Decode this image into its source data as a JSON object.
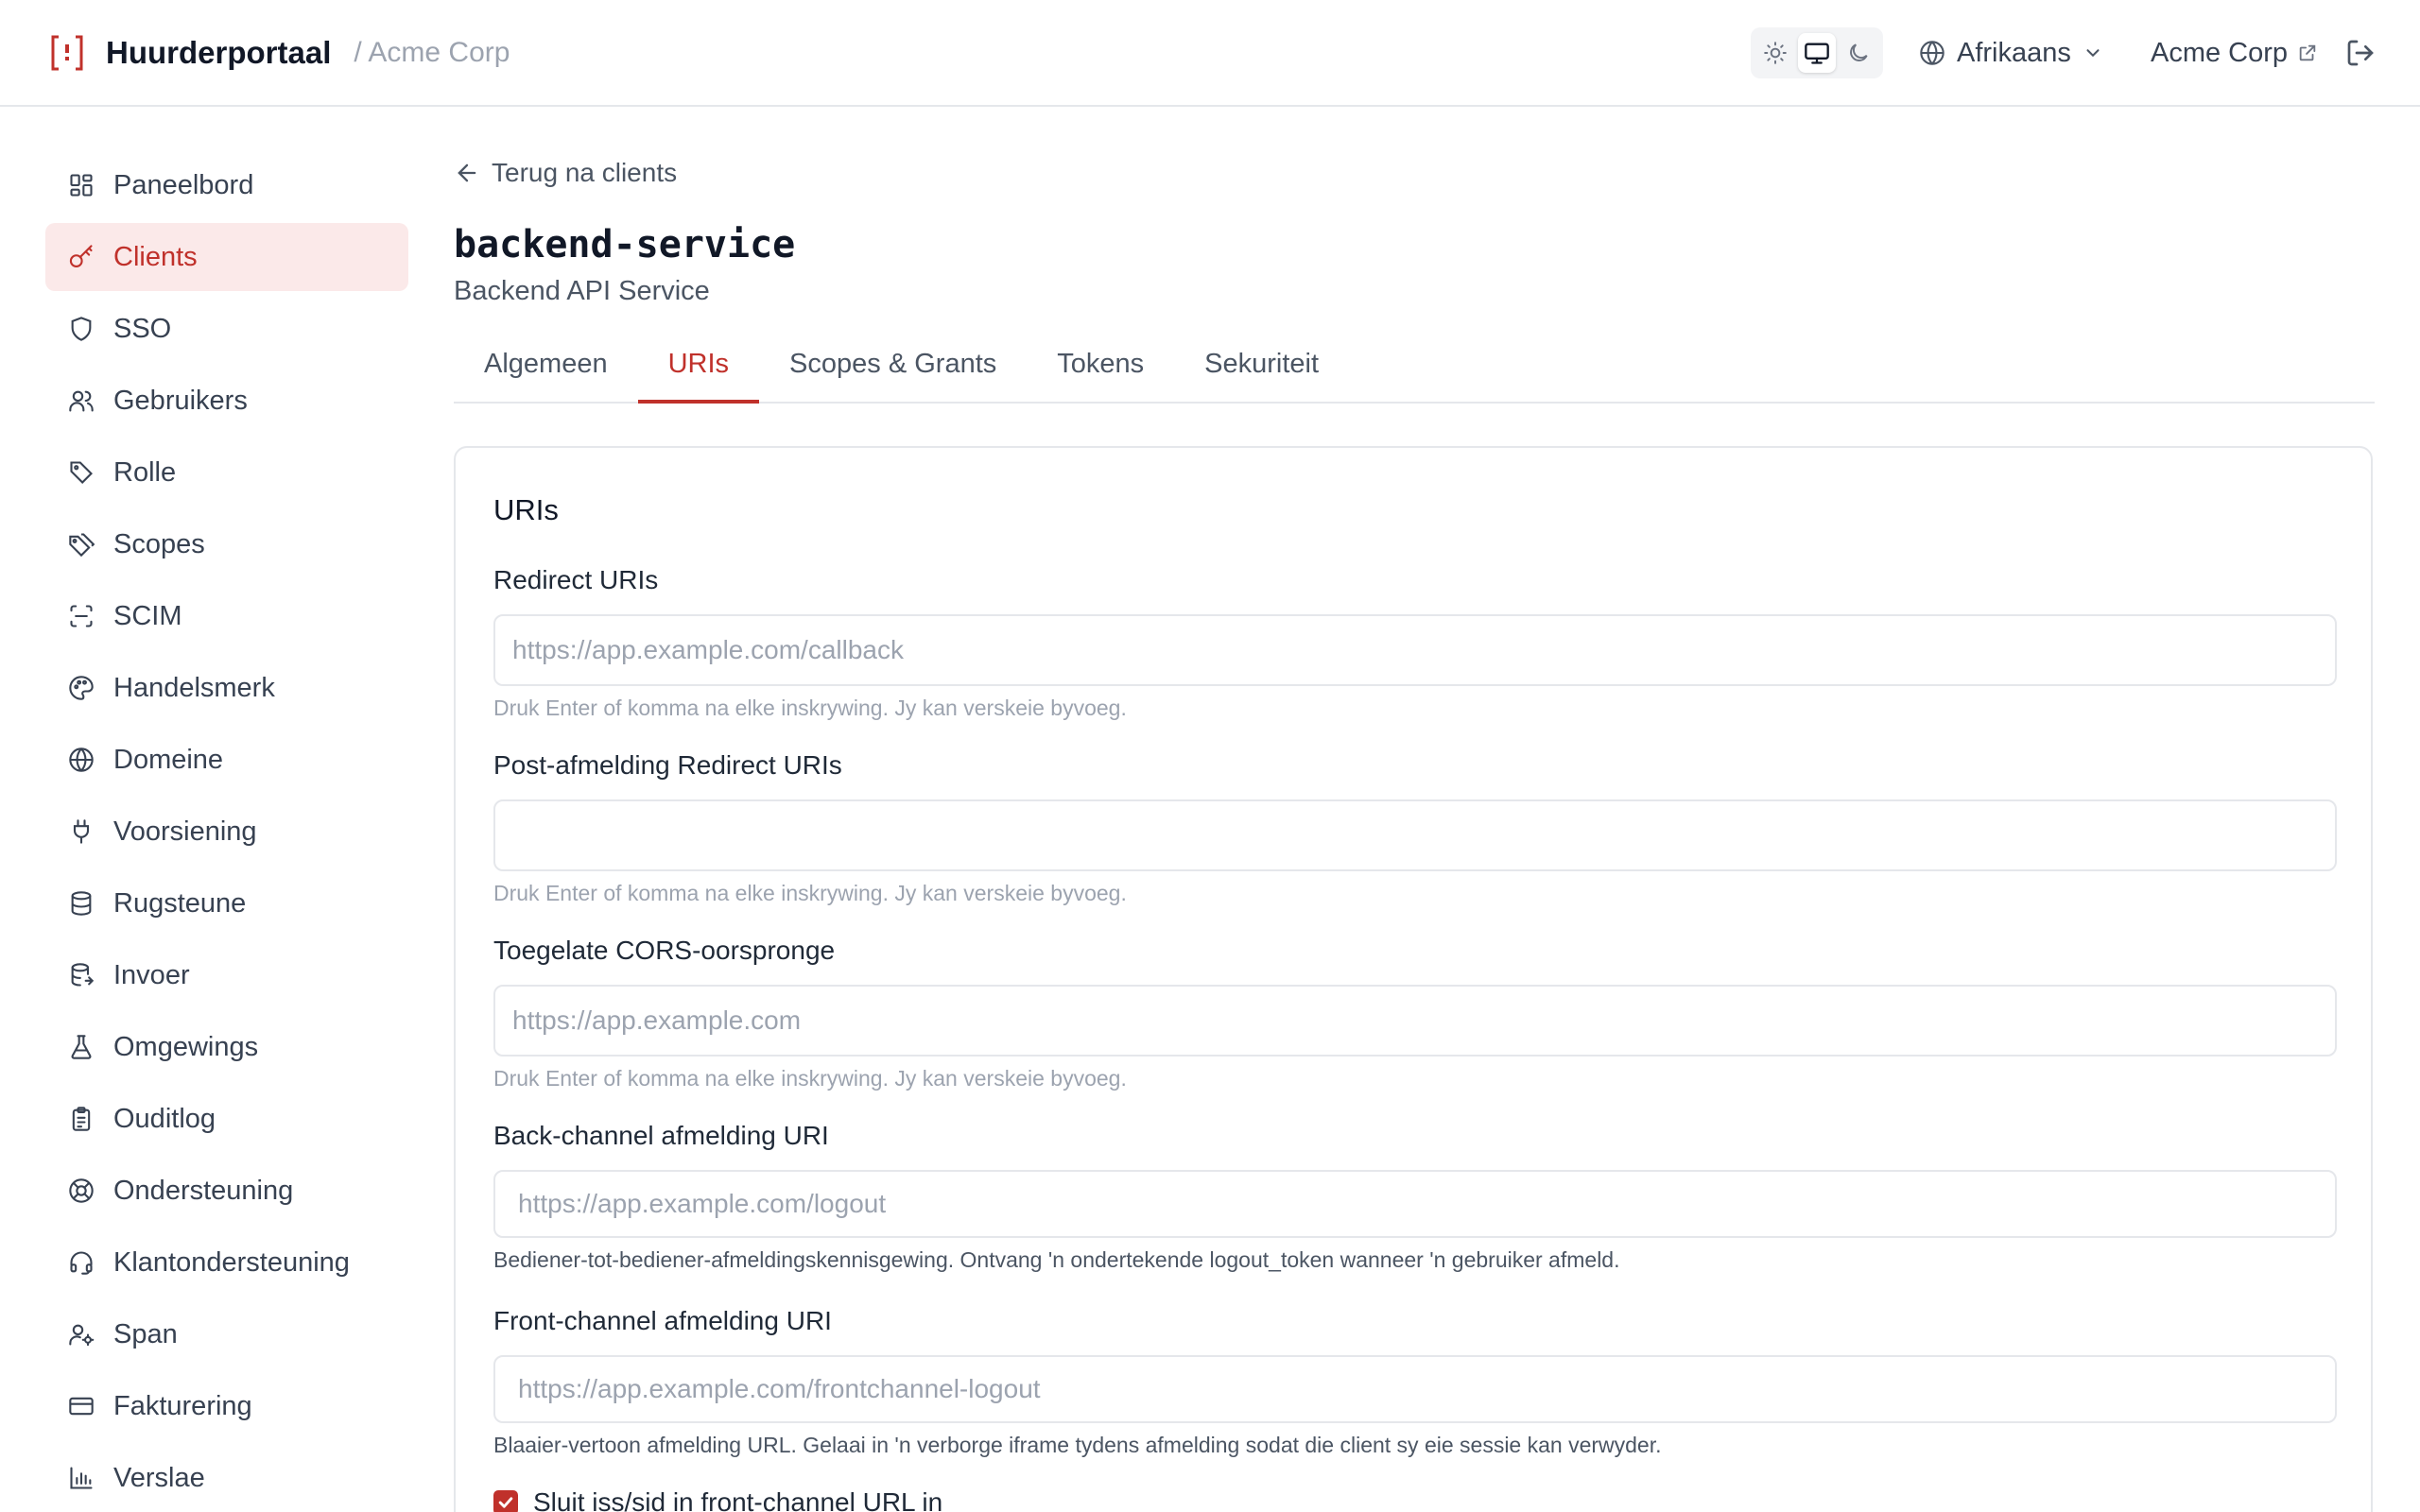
{
  "header": {
    "app_name": "Huurderportaal",
    "tenant_crumb": "/ Acme Corp",
    "language": "Afrikaans",
    "tenant_link": "Acme Corp"
  },
  "sidebar": {
    "items": [
      {
        "label": "Paneelbord",
        "icon": "dashboard-icon"
      },
      {
        "label": "Clients",
        "icon": "key-icon"
      },
      {
        "label": "SSO",
        "icon": "shield-icon"
      },
      {
        "label": "Gebruikers",
        "icon": "users-icon"
      },
      {
        "label": "Rolle",
        "icon": "tag-icon"
      },
      {
        "label": "Scopes",
        "icon": "tags-icon"
      },
      {
        "label": "SCIM",
        "icon": "scan-icon"
      },
      {
        "label": "Handelsmerk",
        "icon": "palette-icon"
      },
      {
        "label": "Domeine",
        "icon": "globe-icon"
      },
      {
        "label": "Voorsiening",
        "icon": "plug-icon"
      },
      {
        "label": "Rugsteune",
        "icon": "database-icon"
      },
      {
        "label": "Invoer",
        "icon": "database-import-icon"
      },
      {
        "label": "Omgewings",
        "icon": "flask-icon"
      },
      {
        "label": "Ouditlog",
        "icon": "clipboard-icon"
      },
      {
        "label": "Ondersteuning",
        "icon": "lifebuoy-icon"
      },
      {
        "label": "Klantondersteuning",
        "icon": "headset-icon"
      },
      {
        "label": "Span",
        "icon": "user-cog-icon"
      },
      {
        "label": "Fakturering",
        "icon": "credit-card-icon"
      },
      {
        "label": "Verslae",
        "icon": "bar-chart-icon"
      }
    ],
    "active_index": 1
  },
  "main": {
    "back_label": "Terug na clients",
    "title": "backend-service",
    "subtitle": "Backend API Service",
    "tabs": [
      {
        "label": "Algemeen"
      },
      {
        "label": "URIs"
      },
      {
        "label": "Scopes & Grants"
      },
      {
        "label": "Tokens"
      },
      {
        "label": "Sekuriteit"
      }
    ],
    "active_tab": 1
  },
  "card": {
    "title": "URIs",
    "fields": [
      {
        "label": "Redirect URIs",
        "placeholder": "https://app.example.com/callback",
        "help": "Druk Enter of komma na elke inskrywing. Jy kan verskeie byvoeg."
      },
      {
        "label": "Post-afmelding Redirect URIs",
        "placeholder": "",
        "help": "Druk Enter of komma na elke inskrywing. Jy kan verskeie byvoeg."
      },
      {
        "label": "Toegelate CORS-oorspronge",
        "placeholder": "https://app.example.com",
        "help": "Druk Enter of komma na elke inskrywing. Jy kan verskeie byvoeg."
      },
      {
        "label": "Back-channel afmelding URI",
        "placeholder": "https://app.example.com/logout",
        "help": "Bediener-tot-bediener-afmeldingskennisgewing. Ontvang 'n ondertekende logout_token wanneer 'n gebruiker afmeld."
      },
      {
        "label": "Front-channel afmelding URI",
        "placeholder": "https://app.example.com/frontchannel-logout",
        "help": "Blaaier-vertoon afmelding URL. Gelaai in 'n verborge iframe tydens afmelding sodat die client sy eie sessie kan verwyder."
      }
    ],
    "checkbox_label": "Sluit iss/sid in front-channel URL in",
    "checkbox_checked": true
  },
  "colors": {
    "accent": "#c0312b",
    "active_bg": "#fbe9e9",
    "border": "#e5e7eb"
  }
}
